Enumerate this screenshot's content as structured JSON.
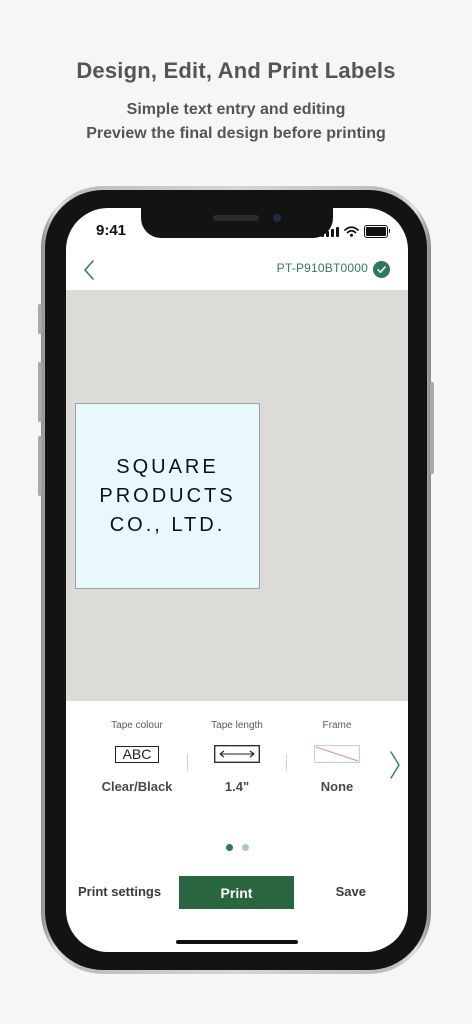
{
  "promo": {
    "headline": "Design, Edit, And Print Labels",
    "subline1": "Simple text entry and editing",
    "subline2": "Preview the final design before printing"
  },
  "status_bar": {
    "time": "9:41"
  },
  "header": {
    "device_name": "PT-P910BT0000"
  },
  "label": {
    "lines": [
      "SQUARE",
      "PRODUCTS",
      "CO., LTD."
    ]
  },
  "settings": [
    {
      "title": "Tape colour",
      "value": "Clear/Black",
      "icon_text": "ABC"
    },
    {
      "title": "Tape length",
      "value": "1.4\""
    },
    {
      "title": "Frame",
      "value": "None"
    }
  ],
  "pager": {
    "pages": 2,
    "current": 1
  },
  "actions": {
    "print_settings": "Print settings",
    "print": "Print",
    "save": "Save"
  },
  "colors": {
    "accent": "#296640",
    "device_text": "#2f7f57",
    "canvas_bg": "#dcdbd8",
    "label_bg": "#e8f8fc"
  }
}
